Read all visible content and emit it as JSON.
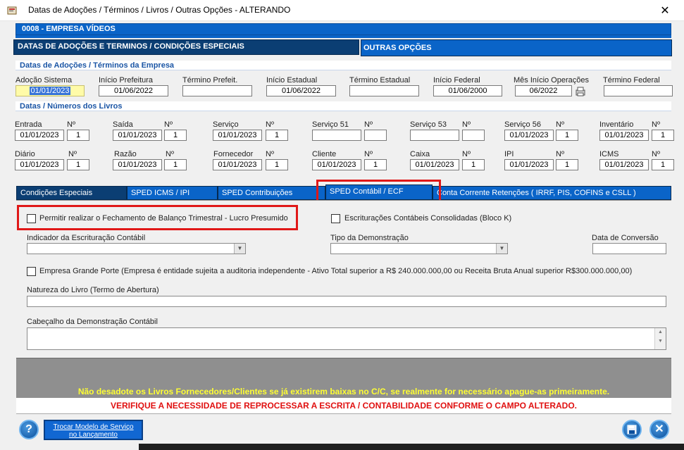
{
  "window": {
    "title": "Datas de Adoções / Términos / Livros / Outras Opções   -   ALTERANDO",
    "close_glyph": "✕"
  },
  "company_bar": "0008   -   EMPRESA VÍDEOS",
  "main_tabs": [
    "DATAS DE ADOÇÕES E TERMINOS / CONDIÇÕES ESPECIAIS",
    "OUTRAS OPÇÕES"
  ],
  "section_adocoes": {
    "title": "Datas de Adoções / Términos da Empresa",
    "fields": [
      {
        "label": "Adoção Sistema",
        "value": "01/01/2023"
      },
      {
        "label": "Início Prefeitura",
        "value": "01/06/2022"
      },
      {
        "label": "Término Prefeit.",
        "value": ""
      },
      {
        "label": "Início Estadual",
        "value": "01/06/2022"
      },
      {
        "label": "Término Estadual",
        "value": ""
      },
      {
        "label": "Início Federal",
        "value": "01/06/2000"
      },
      {
        "label": "Mês Início Operações",
        "value": "06/2022"
      },
      {
        "label": "Término Federal",
        "value": ""
      }
    ]
  },
  "section_livros": {
    "title": "Datas / Números dos Livros",
    "no_label": "Nº",
    "row1": [
      {
        "label": "Entrada",
        "date": "01/01/2023",
        "num": "1"
      },
      {
        "label": "Saída",
        "date": "01/01/2023",
        "num": "1"
      },
      {
        "label": "Serviço",
        "date": "01/01/2023",
        "num": "1"
      },
      {
        "label": "Serviço 51",
        "date": "",
        "num": ""
      },
      {
        "label": "Serviço 53",
        "date": "",
        "num": ""
      },
      {
        "label": "Serviço 56",
        "date": "01/01/2023",
        "num": "1"
      },
      {
        "label": "Inventário",
        "date": "01/01/2023",
        "num": "1"
      }
    ],
    "row2": [
      {
        "label": "Diário",
        "date": "01/01/2023",
        "num": "1"
      },
      {
        "label": "Razão",
        "date": "01/01/2023",
        "num": "1"
      },
      {
        "label": "Fornecedor",
        "date": "01/01/2023",
        "num": "1"
      },
      {
        "label": "Cliente",
        "date": "01/01/2023",
        "num": "1"
      },
      {
        "label": "Caixa",
        "date": "01/01/2023",
        "num": "1"
      },
      {
        "label": "IPI",
        "date": "01/01/2023",
        "num": "1"
      },
      {
        "label": "ICMS",
        "date": "01/01/2023",
        "num": "1"
      }
    ]
  },
  "sub_tabs": [
    "Condições Especiais",
    "SPED ICMS / IPI",
    "SPED Contribuições",
    "SPED Contábil / ECF",
    "Conta Corrente Retenções ( IRRF,  PIS,  COFINS  e  CSLL )"
  ],
  "sped_contabil": {
    "chk_fechamento": "Permitir realizar o Fechamento de Balanço Trimestral - Lucro Presumido",
    "chk_consolidadas": "Escriturações Contábeis Consolidadas (Bloco K)",
    "indicador_label": "Indicador da Escrituração Contábil",
    "tipo_label": "Tipo da Demonstração",
    "data_conversao_label": "Data de Conversão",
    "chk_grande_porte": "Empresa Grande Porte (Empresa é entidade sujeita a auditoria independente - Ativo Total superior a R$ 240.000.000,00 ou Receita Bruta Anual superior R$300.000.000,00)",
    "natureza_label": "Natureza do Livro (Termo de Abertura)",
    "cabecalho_label": "Cabeçalho da Demonstração Contábil"
  },
  "warnings": {
    "line1": "Não desadote os Livros Fornecedores/Clientes se já existirem baixas no C/C, se realmente for necessário apague-as primeiramente.",
    "line2": "VERIFIQUE A NECESSIDADE DE REPROCESSAR A ESCRITA / CONTABILIDADE CONFORME O CAMPO ALTERADO."
  },
  "footer": {
    "help_glyph": "?",
    "trocar_line1": "Trocar Modelo de Serviço",
    "trocar_line2": "no Lançamento",
    "close_glyph": "✕"
  }
}
